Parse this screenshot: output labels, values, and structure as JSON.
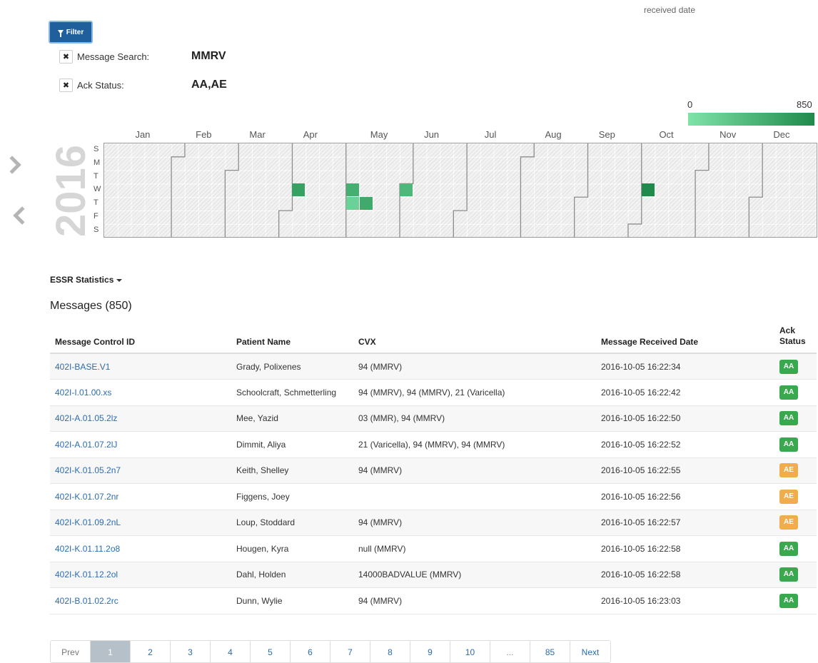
{
  "header": {
    "top_note": "received date"
  },
  "filter": {
    "button_label": "Filter",
    "rows": [
      {
        "label": "Message Search:",
        "value": "MMRV"
      },
      {
        "label": "Ack Status:",
        "value": "AA,AE"
      }
    ]
  },
  "calendar": {
    "year": "2016",
    "legend": {
      "min": "0",
      "max": "850",
      "color_low": "#7fe3a8",
      "color_high": "#1f8a4c"
    },
    "months": [
      "Jan",
      "Feb",
      "Mar",
      "Apr",
      "May",
      "Jun",
      "Jul",
      "Aug",
      "Sep",
      "Oct",
      "Nov",
      "Dec"
    ],
    "days": [
      "S",
      "M",
      "T",
      "W",
      "T",
      "F",
      "S"
    ],
    "active_days": [
      {
        "date": "2016-04-06",
        "level": 0.75
      },
      {
        "date": "2016-05-04",
        "level": 0.6
      },
      {
        "date": "2016-05-05",
        "level": 0.2
      },
      {
        "date": "2016-05-12",
        "level": 0.65
      },
      {
        "date": "2016-06-01",
        "level": 0.5
      },
      {
        "date": "2016-10-05",
        "level": 1.0
      }
    ]
  },
  "stats_toggle": "ESSR Statistics",
  "messages": {
    "title": "Messages (850)",
    "columns": [
      "Message Control ID",
      "Patient Name",
      "CVX",
      "Message Received Date",
      "Ack Status"
    ],
    "rows": [
      {
        "id": "402I-BASE.V1",
        "patient": "Grady, Polixenes",
        "cvx": "94 (MMRV)",
        "received": "2016-10-05 16:22:34",
        "ack": "AA"
      },
      {
        "id": "402I-I.01.00.xs",
        "patient": "Schoolcraft, Schmetterling",
        "cvx": "94 (MMRV), 94 (MMRV), 21 (Varicella)",
        "received": "2016-10-05 16:22:42",
        "ack": "AA"
      },
      {
        "id": "402I-A.01.05.2lz",
        "patient": "Mee, Yazid",
        "cvx": "03 (MMR), 94 (MMRV)",
        "received": "2016-10-05 16:22:50",
        "ack": "AA"
      },
      {
        "id": "402I-A.01.07.2lJ",
        "patient": "Dimmit, Aliya",
        "cvx": "21 (Varicella), 94 (MMRV), 94 (MMRV)",
        "received": "2016-10-05 16:22:52",
        "ack": "AA"
      },
      {
        "id": "402I-K.01.05.2n7",
        "patient": "Keith, Shelley",
        "cvx": "94 (MMRV)",
        "received": "2016-10-05 16:22:55",
        "ack": "AE"
      },
      {
        "id": "402I-K.01.07.2nr",
        "patient": "Figgens, Joey",
        "cvx": "",
        "received": "2016-10-05 16:22:56",
        "ack": "AE"
      },
      {
        "id": "402I-K.01.09.2nL",
        "patient": "Loup, Stoddard",
        "cvx": "94 (MMRV)",
        "received": "2016-10-05 16:22:57",
        "ack": "AE"
      },
      {
        "id": "402I-K.01.11.2o8",
        "patient": "Hougen, Kyra",
        "cvx": "null (MMRV)",
        "received": "2016-10-05 16:22:58",
        "ack": "AA"
      },
      {
        "id": "402I-K.01.12.2ol",
        "patient": "Dahl, Holden",
        "cvx": "14000BADVALUE (MMRV)",
        "received": "2016-10-05 16:22:58",
        "ack": "AA"
      },
      {
        "id": "402I-B.01.02.2rc",
        "patient": "Dunn, Wylie",
        "cvx": "94 (MMRV)",
        "received": "2016-10-05 16:23:03",
        "ack": "AA"
      }
    ],
    "ack_colors": {
      "AA": "#3aa84f",
      "AE": "#f0ad4e"
    }
  },
  "pagination": {
    "items": [
      "Prev",
      "1",
      "2",
      "3",
      "4",
      "5",
      "6",
      "7",
      "8",
      "9",
      "10",
      "...",
      "85",
      "Next"
    ],
    "active": "1"
  }
}
